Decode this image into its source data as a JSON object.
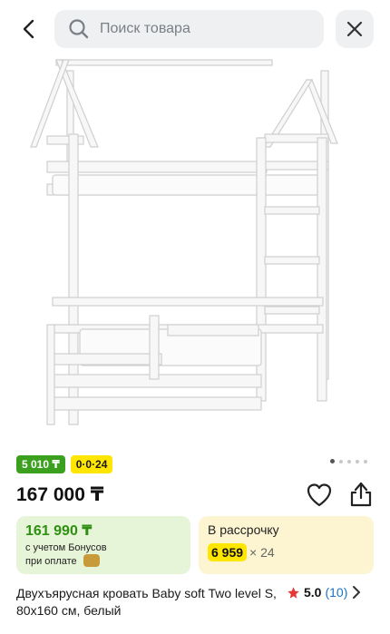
{
  "search": {
    "placeholder": "Поиск товара"
  },
  "badges": {
    "bonus": "5 010 ₸",
    "installment": "0·0·24"
  },
  "price": "167 000 ₸",
  "bonus_card": {
    "price": "161 990 ₸",
    "note_line1": "с учетом Бонусов",
    "note_line2": "при оплате"
  },
  "credit_card": {
    "title": "В рассрочку",
    "amount": "6 959",
    "months": "× 24"
  },
  "product": {
    "title": "Двухъярусная кровать Baby soft Two level S, 80x160 см, белый"
  },
  "rating": {
    "score": "5.0",
    "count": "(10)"
  },
  "gallery": {
    "dots_count": 5,
    "active_index": 0
  },
  "colors": {
    "bonus_green": "#3aa01d",
    "installment_yellow": "#ffe600",
    "star_red": "#e53935",
    "link_blue": "#1a73c9"
  },
  "icons": [
    "chevron-left-icon",
    "search-icon",
    "close-icon",
    "heart-icon",
    "share-icon",
    "star-icon",
    "chevron-right-icon",
    "bonus-coin-icon"
  ]
}
